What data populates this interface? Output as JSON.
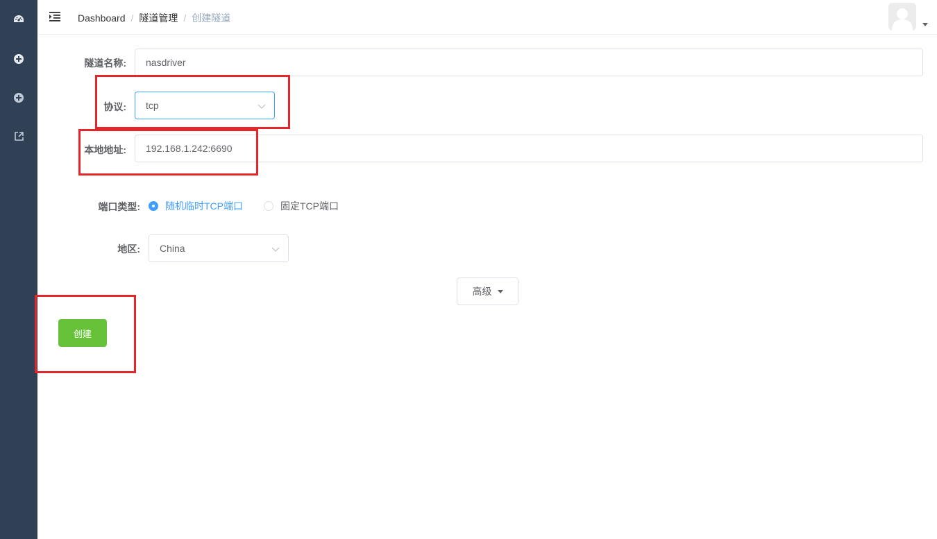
{
  "sidebar": {
    "icons": [
      "dashboard-icon",
      "add-circle-icon",
      "add-circle-icon",
      "external-link-icon"
    ]
  },
  "header": {
    "breadcrumb": [
      "Dashboard",
      "隧道管理",
      "创建隧道"
    ]
  },
  "form": {
    "name": {
      "label": "隧道名称:",
      "value": "nasdriver"
    },
    "protocol": {
      "label": "协议:",
      "value": "tcp"
    },
    "local_address": {
      "label": "本地地址:",
      "value": "192.168.1.242:6690"
    },
    "port_type": {
      "label": "端口类型:",
      "options": [
        "随机临时TCP端口",
        "固定TCP端口"
      ],
      "selected": "随机临时TCP端口"
    },
    "region": {
      "label": "地区:",
      "value": "China"
    },
    "advanced_label": "高级",
    "create_label": "创建"
  },
  "colors": {
    "sidebar": "#304156",
    "primary": "#409eff",
    "success": "#67c23a",
    "annotation": "#e3262a"
  }
}
